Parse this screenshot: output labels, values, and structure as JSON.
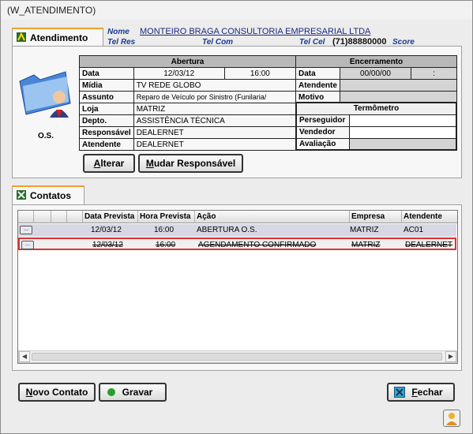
{
  "window": {
    "title": "(W_ATENDIMENTO)"
  },
  "tabs": {
    "atendimento": "Atendimento",
    "contatos": "Contatos"
  },
  "header": {
    "nome_label": "Nome",
    "nome_value": "MONTEIRO BRAGA CONSULTORIA EMPRESARIAL LTDA",
    "telres_label": "Tel Res",
    "telcom_label": "Tel Com",
    "telcel_label": "Tel Cel",
    "telcel_value": "(71)88880000",
    "score_label": "Score"
  },
  "os_label": "O.S.",
  "abertura": {
    "title": "Abertura",
    "data_label": "Data",
    "data_value": "12/03/12",
    "hora_value": "16:00",
    "midia_label": "Mídia",
    "midia_value": "TV REDE GLOBO",
    "assunto_label": "Assunto",
    "assunto_value": "Reparo de Veículo por Sinistro (Funilaria/",
    "loja_label": "Loja",
    "loja_value": "MATRIZ",
    "depto_label": "Depto.",
    "depto_value": "ASSISTÊNCIA TÉCNICA",
    "responsavel_label": "Responsável",
    "responsavel_value": "DEALERNET",
    "atendente_label": "Atendente",
    "atendente_value": "DEALERNET"
  },
  "encerramento": {
    "title": "Encerramento",
    "data_label": "Data",
    "data_value": "00/00/00",
    "hora_value": ":",
    "atendente_label": "Atendente",
    "motivo_label": "Motivo"
  },
  "termometro": {
    "title": "Termômetro",
    "perseguidor_label": "Perseguidor",
    "vendedor_label": "Vendedor",
    "avaliacao_label": "Avaliação"
  },
  "buttons": {
    "alterar_u": "A",
    "alterar_rest": "lterar",
    "mudar_u": "M",
    "mudar_rest": "udar Responsável",
    "novo_u": "N",
    "novo_rest": "ovo Contato",
    "gravar": "Gravar",
    "fechar_u": "F",
    "fechar_rest": "echar"
  },
  "contatos_table": {
    "columns": [
      "Data Prevista",
      "Hora Prevista",
      "Ação",
      "Empresa",
      "Atendente"
    ],
    "rows": [
      {
        "data": "12/03/12",
        "hora": "16:00",
        "acao": "ABERTURA O.S.",
        "empresa": "MATRIZ",
        "atendente": "AC01",
        "struck": false
      },
      {
        "data": "12/03/12",
        "hora": "16:00",
        "acao": "AGENDAMENTO CONFIRMADO",
        "empresa": "MATRIZ",
        "atendente": "DEALERNET",
        "struck": true
      }
    ]
  },
  "colors": {
    "accent_tab": "#f0a030",
    "link_blue": "#1a2a80",
    "selected_row_border": "#e03030"
  }
}
